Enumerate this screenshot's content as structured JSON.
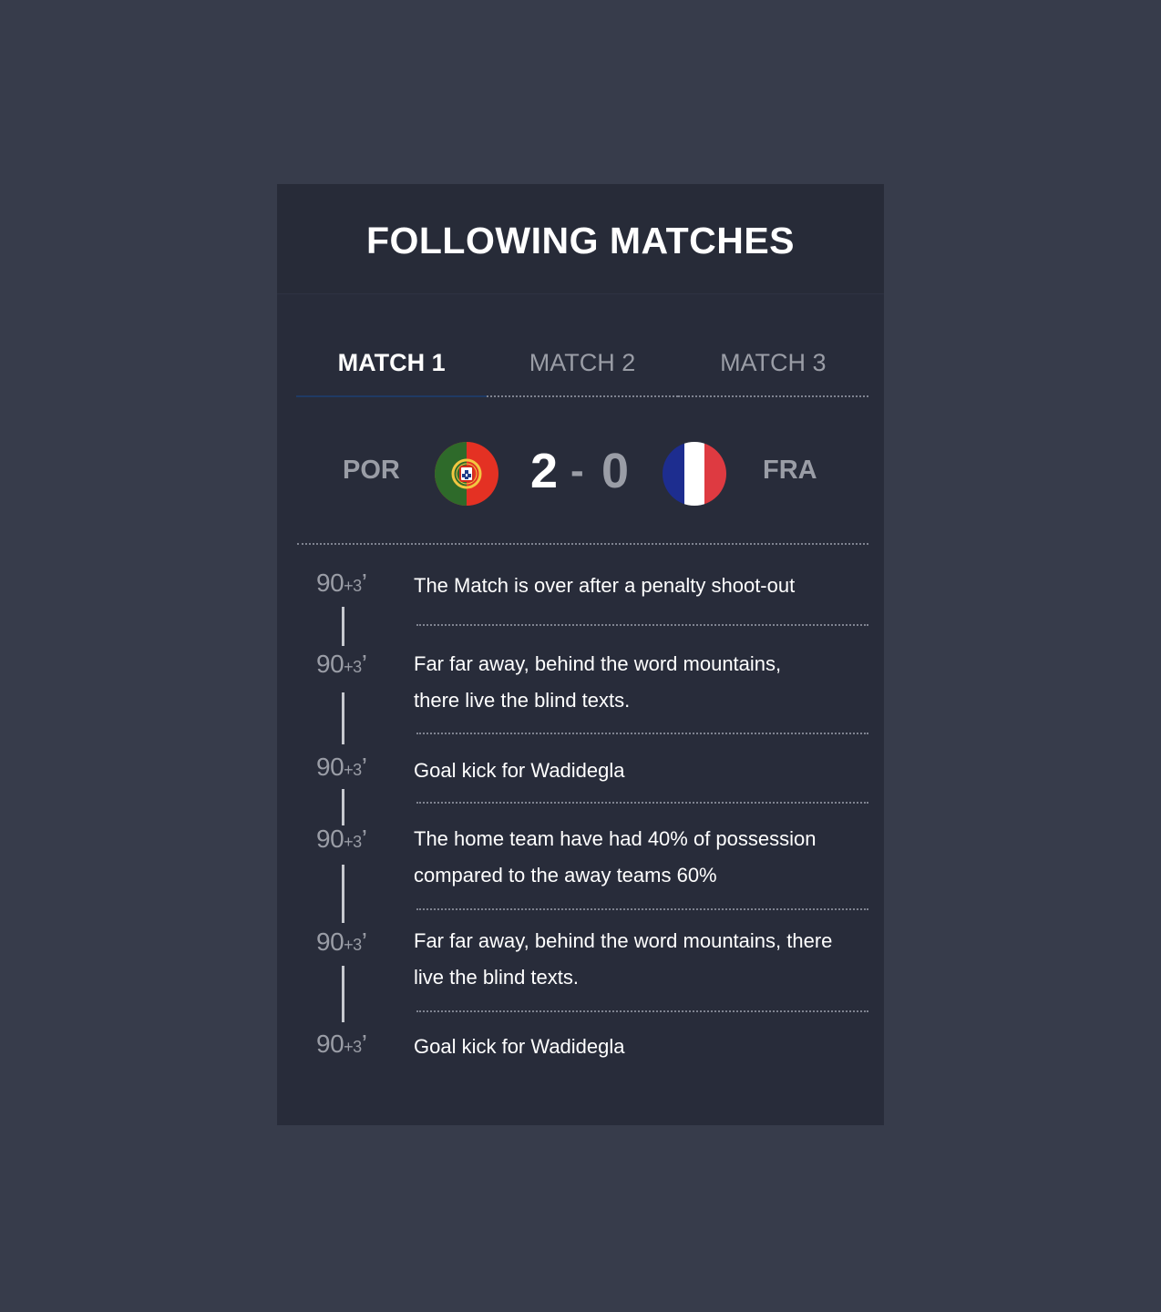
{
  "card": {
    "title": "FOLLOWING MATCHES"
  },
  "tabs": [
    {
      "label": "MATCH 1",
      "active": true
    },
    {
      "label": "MATCH 2",
      "active": false
    },
    {
      "label": "MATCH 3",
      "active": false
    }
  ],
  "match": {
    "home": {
      "code": "POR",
      "score": "2",
      "flag": "portugal-flag-icon"
    },
    "separator": "-",
    "away": {
      "code": "FRA",
      "score": "0",
      "flag": "france-flag-icon"
    }
  },
  "colors": {
    "page_background": "#373c4b",
    "card_background": "#282c3a",
    "active_tab_underline": "#1f3a64",
    "muted_text": "#9a9da6"
  },
  "events": [
    {
      "time_main": "90",
      "time_extra": "+3",
      "time_suffix": "’",
      "text": "The Match is over after a penalty shoot-out"
    },
    {
      "time_main": "90",
      "time_extra": "+3",
      "time_suffix": "’",
      "text": "Far far away, behind the word mountains, there live the blind texts."
    },
    {
      "time_main": "90",
      "time_extra": "+3",
      "time_suffix": "’",
      "text": "Goal kick for Wadidegla"
    },
    {
      "time_main": "90",
      "time_extra": "+3",
      "time_suffix": "’",
      "text": "The home team have had 40% of possession compared to the away teams 60%"
    },
    {
      "time_main": "90",
      "time_extra": "+3",
      "time_suffix": "’",
      "text": "Far far away, behind the word mountains, there live the blind texts."
    },
    {
      "time_main": "90",
      "time_extra": "+3",
      "time_suffix": "’",
      "text": "Goal kick for Wadidegla"
    }
  ]
}
